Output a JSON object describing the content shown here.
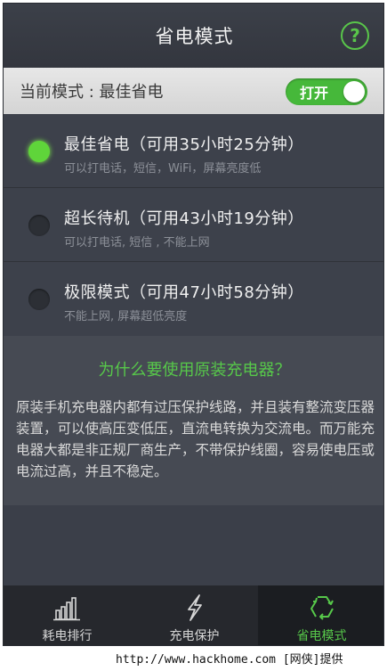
{
  "header": {
    "title": "省电模式",
    "help_icon": "question-circle-icon"
  },
  "current_mode": {
    "text": "当前模式 : 最佳省电",
    "toggle_label": "打开",
    "toggle_on": true
  },
  "options": [
    {
      "title": "最佳省电（可用35小时25分钟）",
      "subtitle": "可以打电话，短信，WiFi，屏幕亮度低",
      "selected": true
    },
    {
      "title": "超长待机（可用43小时19分钟）",
      "subtitle": "可以打电话, 短信 , 不能上网",
      "selected": false
    },
    {
      "title": "极限模式（可用47小时58分钟）",
      "subtitle": "不能上网, 屏幕超低亮度",
      "selected": false
    }
  ],
  "info": {
    "question": "为什么要使用原装充电器？",
    "answer": "原装手机充电器内都有过压保护线路，并且装有整流变压器装置，可以使高压变低压，直流电转换为交流电。而万能充电器大都是非正规厂商生产，不带保护线圈，容易使电压或电流过高，并且不稳定。"
  },
  "nav": [
    {
      "label": "耗电排行",
      "icon": "bar-chart-icon",
      "active": false
    },
    {
      "label": "充电保护",
      "icon": "lightning-icon",
      "active": false
    },
    {
      "label": "省电模式",
      "icon": "recycle-icon",
      "active": true
    }
  ],
  "watermark": "http://www.hackhome.com [网侠]提供",
  "colors": {
    "accent_green": "#57c84a",
    "bg_dark": "#3b3f49",
    "nav_bg": "#26282d"
  }
}
